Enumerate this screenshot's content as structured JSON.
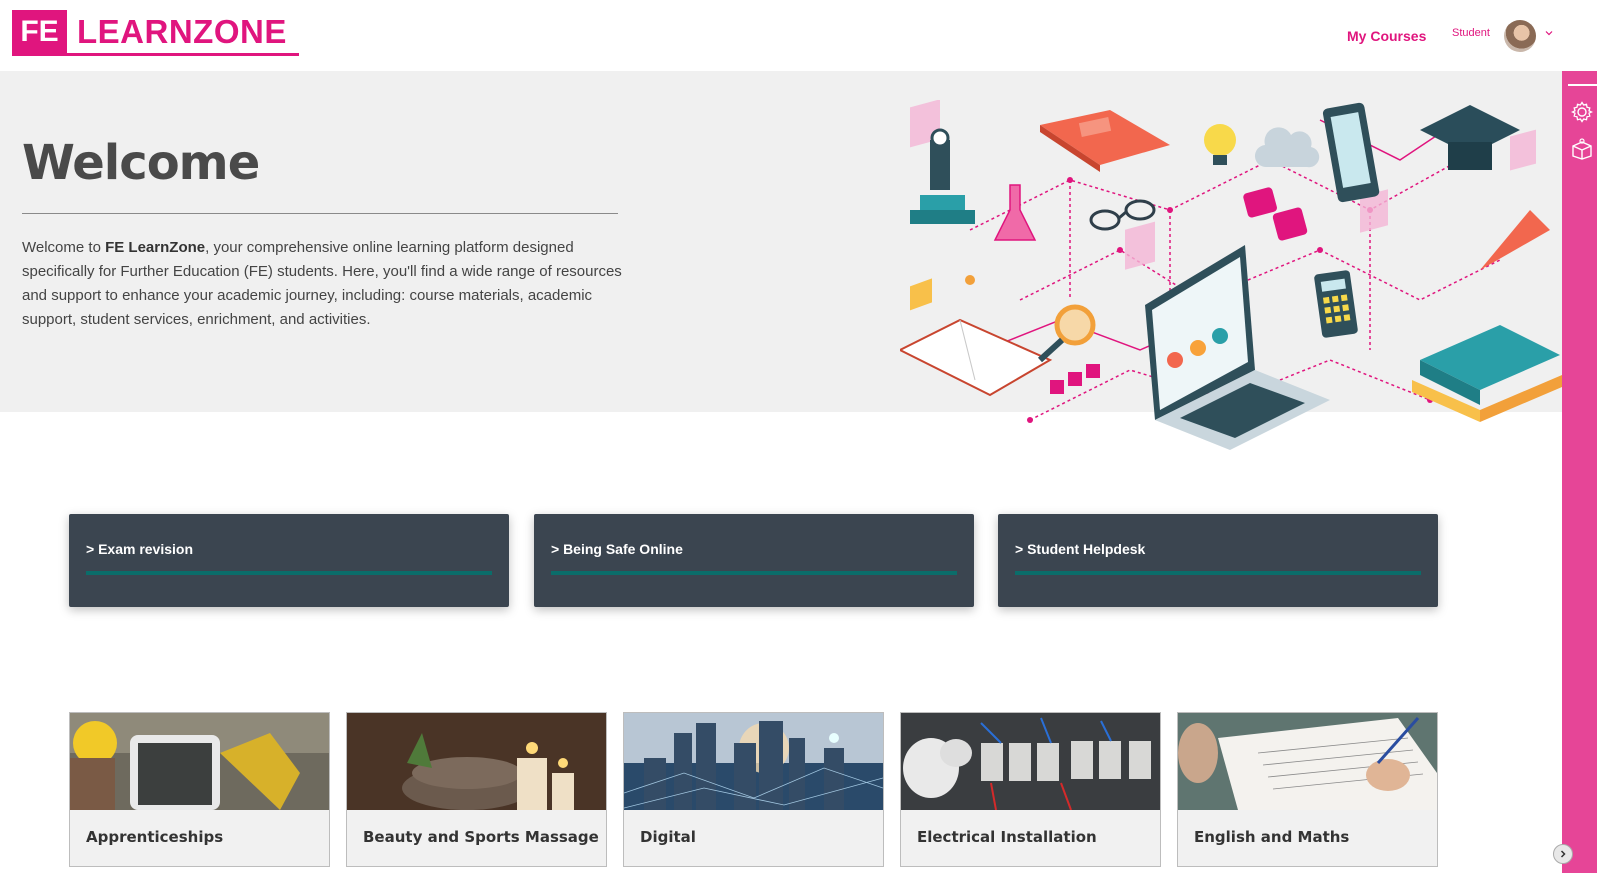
{
  "header": {
    "logo_mark": "FE",
    "logo_text": "LEARNZONE",
    "nav": {
      "my_courses": "My Courses"
    },
    "user": {
      "role": "Student"
    }
  },
  "hero": {
    "title": "Welcome",
    "intro_prefix": "Welcome to ",
    "intro_brand": "FE LearnZone",
    "intro_rest": ", your comprehensive online learning platform designed specifically for Further Education (FE) students. Here, you'll find a wide range of resources and support to enhance your academic journey, including: course materials, academic support, student services, enrichment, and activities."
  },
  "quick_links": [
    {
      "label": ">  Exam revision"
    },
    {
      "label": ">  Being Safe Online"
    },
    {
      "label": ">  Student Helpdesk"
    }
  ],
  "categories": [
    {
      "label": "Apprenticeships"
    },
    {
      "label": "Beauty and Sports Massage"
    },
    {
      "label": "Digital"
    },
    {
      "label": "Electrical Installation"
    },
    {
      "label": "English and Maths"
    }
  ],
  "icons": {
    "rail": [
      "gear-icon",
      "learning-box-icon"
    ],
    "toggle": "chevron-right-icon"
  },
  "colors": {
    "brand_pink": "#e0157e",
    "rail_pink": "#e64597",
    "card_dark": "#3b4550",
    "card_accent": "#0b6d6a"
  }
}
